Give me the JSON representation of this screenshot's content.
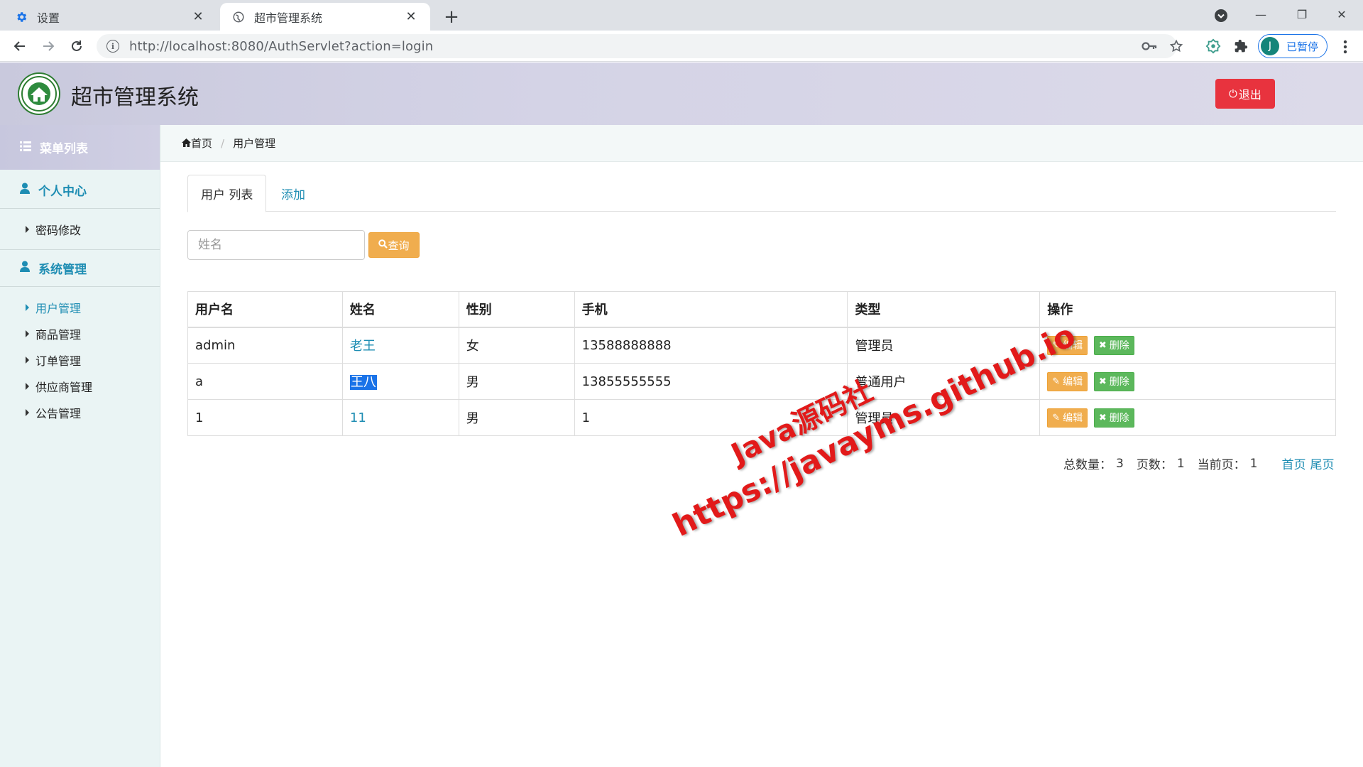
{
  "browser": {
    "tabs": [
      {
        "title": "设置",
        "icon": "gear-icon",
        "active": false
      },
      {
        "title": "超市管理系统",
        "icon": "globe-icon",
        "active": true
      }
    ],
    "url_host": "http://localhost",
    "url_rest": ":8080/AuthServlet?action=login",
    "profile_initial": "J",
    "profile_label": "已暂停"
  },
  "header": {
    "title": "超市管理系统",
    "logout_label": "退出"
  },
  "sidebar": {
    "menu_title": "菜单列表",
    "groups": [
      {
        "label": "个人中心",
        "items": [
          "密码修改"
        ]
      },
      {
        "label": "系统管理",
        "items": [
          "用户管理",
          "商品管理",
          "订单管理",
          "供应商管理",
          "公告管理"
        ]
      }
    ],
    "active_item": "用户管理"
  },
  "breadcrumb": {
    "home": "首页",
    "current": "用户管理"
  },
  "content": {
    "tab_list": "用户 列表",
    "tab_add": "添加",
    "search_placeholder": "姓名",
    "search_button": "查询",
    "table": {
      "headers": [
        "用户名",
        "姓名",
        "性别",
        "手机",
        "类型",
        "操作"
      ],
      "rows": [
        {
          "username": "admin",
          "name": "老王",
          "gender": "女",
          "phone": "13588888888",
          "type": "管理员"
        },
        {
          "username": "a",
          "name": "王八",
          "gender": "男",
          "phone": "13855555555",
          "type": "普通用户"
        },
        {
          "username": "1",
          "name": "11",
          "gender": "男",
          "phone": "1",
          "type": "管理员"
        }
      ],
      "edit_label": "编辑",
      "delete_label": "删除"
    },
    "pager": {
      "total_label": "总数量：",
      "total": "3",
      "pages_label": "页数：",
      "pages": "1",
      "current_label": "当前页：",
      "current": "1",
      "first": "首页",
      "last": "尾页"
    }
  },
  "watermark": {
    "line1": "Java源码社",
    "line2": "https://javayms.github.io"
  },
  "colors": {
    "accent": "#1e8db3",
    "logout": "#e8333e",
    "warning": "#f0ad4e",
    "success": "#5cb85c"
  }
}
